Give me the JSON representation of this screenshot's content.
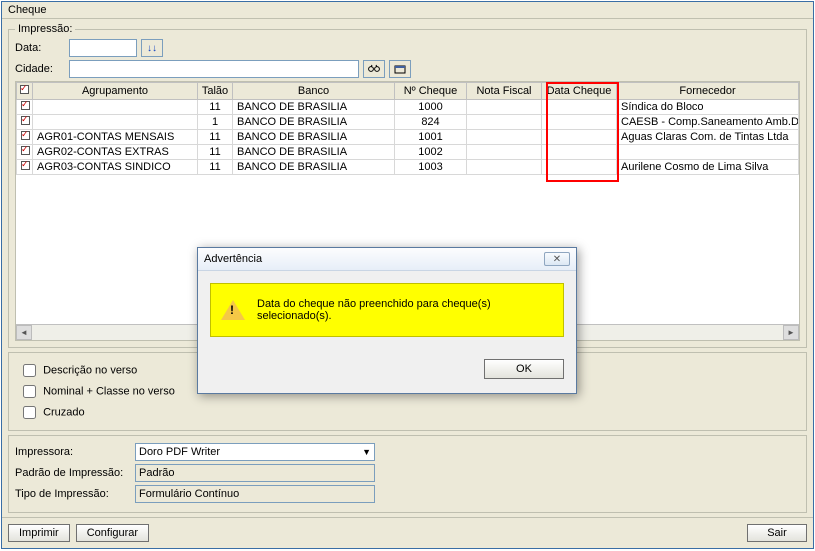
{
  "window": {
    "title": "Cheque"
  },
  "impressao": {
    "legend": "Impressão:",
    "data_label": "Data:",
    "cidade_label": "Cidade:",
    "data_value": "",
    "cidade_value": "",
    "down_icon": "↓↓",
    "binoc_icon": "🔍",
    "card_icon": "🗂"
  },
  "grid": {
    "headers": {
      "agrup": "Agrupamento",
      "talao": "Talão",
      "banco": "Banco",
      "ncheque": "Nº Cheque",
      "nota": "Nota Fiscal",
      "datacheque": "Data Cheque",
      "forn": "Fornecedor"
    },
    "rows": [
      {
        "agrup": "",
        "talao": "11",
        "banco": "BANCO DE BRASILIA",
        "ncheque": "1000",
        "nota": "",
        "datacheque": "",
        "forn": "Síndica do Bloco"
      },
      {
        "agrup": "",
        "talao": "1",
        "banco": "BANCO DE BRASILIA",
        "ncheque": "824",
        "nota": "",
        "datacheque": "",
        "forn": "CAESB - Comp.Saneamento Amb.DF"
      },
      {
        "agrup": "AGR01-CONTAS MENSAIS",
        "talao": "11",
        "banco": "BANCO DE BRASILIA",
        "ncheque": "1001",
        "nota": "",
        "datacheque": "",
        "forn": "Aguas Claras Com. de Tintas Ltda"
      },
      {
        "agrup": "AGR02-CONTAS EXTRAS",
        "talao": "11",
        "banco": "BANCO DE BRASILIA",
        "ncheque": "1002",
        "nota": "",
        "datacheque": "",
        "forn": ""
      },
      {
        "agrup": "AGR03-CONTAS SINDICO",
        "talao": "11",
        "banco": "BANCO DE BRASILIA",
        "ncheque": "1003",
        "nota": "",
        "datacheque": "",
        "forn": "Aurilene Cosmo de Lima Silva"
      }
    ]
  },
  "options": {
    "descricao_verso": "Descrição no verso",
    "nominal_classe": "Nominal + Classe no verso",
    "cruzado": "Cruzado"
  },
  "printer": {
    "impressora_label": "Impressora:",
    "impressora_value": "Doro PDF Writer",
    "padrao_label": "Padrão de Impressão:",
    "padrao_value": "Padrão",
    "tipo_label": "Tipo de Impressão:",
    "tipo_value": "Formulário Contínuo"
  },
  "footer": {
    "imprimir": "Imprimir",
    "configurar": "Configurar",
    "sair": "Sair"
  },
  "modal": {
    "title": "Advertência",
    "close": "✕",
    "message": "Data do cheque não preenchido para cheque(s) selecionado(s).",
    "ok": "OK"
  }
}
